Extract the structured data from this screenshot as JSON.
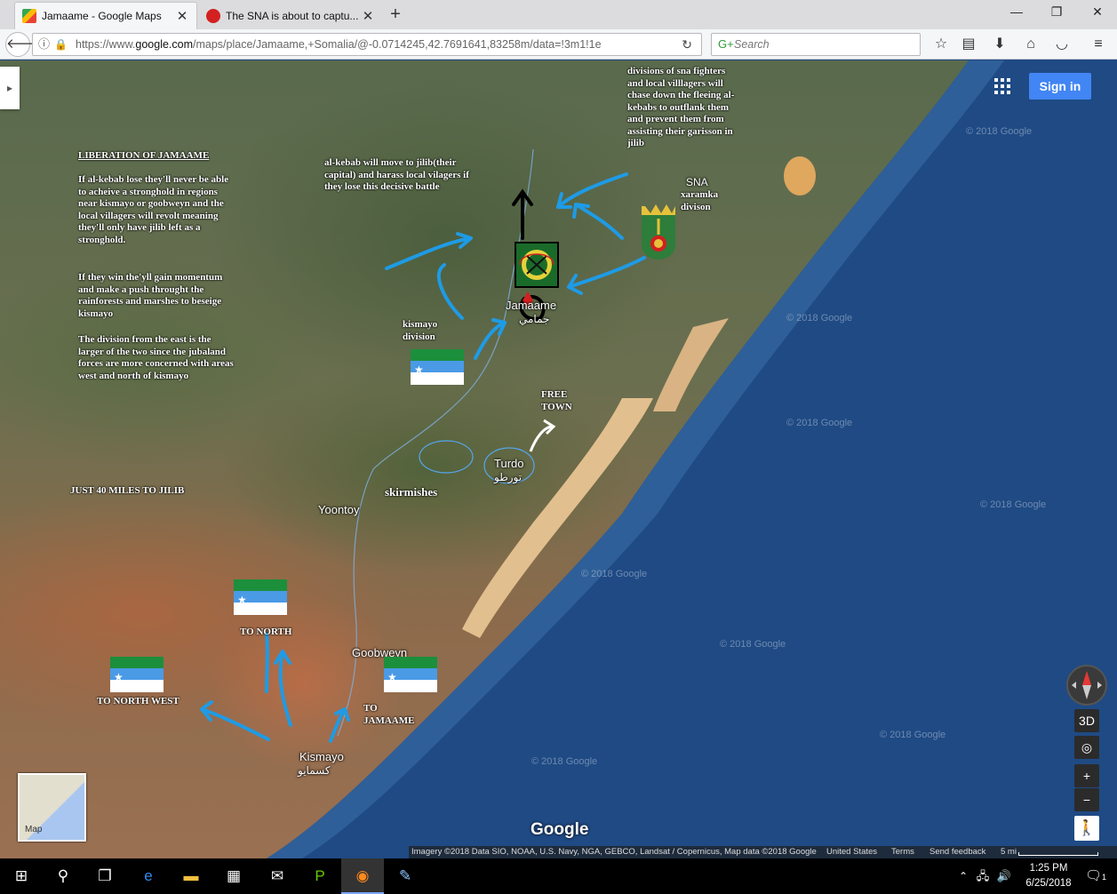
{
  "browser": {
    "tabs": [
      {
        "title": "Jamaame - Google Maps",
        "active": true,
        "favicon_color": "#4285f4"
      },
      {
        "title": "The SNA is about to captu...",
        "active": false,
        "favicon_color": "#d32020"
      }
    ],
    "new_tab_label": "+",
    "window_controls": {
      "minimize": "—",
      "restore": "❐",
      "close": "✕"
    },
    "url": {
      "prefix": "https://www.",
      "domain": "google.com",
      "path": "/maps/place/Jamaame,+Somalia/@-0.0714245,42.7691641,83258m/data=!3m1!1e"
    },
    "search_placeholder": "Search",
    "toolbar_icons": [
      "star-icon",
      "reading-list-icon",
      "download-icon",
      "home-icon",
      "pocket-icon",
      "menu-icon"
    ]
  },
  "map": {
    "place_labels": {
      "jamaame": "Jamaame",
      "jamaame_ar": "جمامي",
      "turdo": "Turdo",
      "turdo_ar": "تورطو",
      "yoontoy": "Yoontoy",
      "goobweyn": "Goobweyn",
      "kismayo": "Kismayo",
      "kismayo_ar": "كسمايو"
    },
    "annotations": {
      "liberation_title": "LIBERATION OF JAMAAME",
      "liberation_p1": "If al-kebab lose they'll never be able to acheive a stronghold in regions near kismayo or goobweyn and the local villagers will revolt meaning they'll only have jilib left as a stronghold.",
      "liberation_p2": "If they win the'yll gain momentum and make a push throught the rainforests and marshes to beseige kismayo",
      "liberation_p3": "The division from the east is the larger of the two since the jubaland forces are more concerned with areas west and north of kismayo",
      "alkebab_move": "al-kebab will move to jilib(their capital) and harass local vilagers if they lose this decisive battle",
      "divisions_chase": "divisions of sna fighters and local villlagers will chase down the fleeing al-kebabs to outflank them and prevent them from assisting their garisson in jilib",
      "sna_label": "SNA",
      "xaramka_label": "xaramka divison",
      "kismayo_division": "kismayo division",
      "free_town": "FREE TOWN",
      "skirmishes": "skirmishes",
      "just_40_miles": "JUST 40 MILES TO JILIB",
      "to_north": "TO NORTH",
      "to_north_west": "TO NORTH WEST",
      "to_jamaame": "TO JAMAAME"
    },
    "watermark": "© 2018 Google",
    "controls": {
      "signin": "Sign in",
      "view_3d": "3D",
      "zoom_in": "+",
      "zoom_out": "−",
      "minimap_label": "Map",
      "google_logo": "Google"
    },
    "attribution": {
      "imagery": "Imagery ©2018 Data SIO, NOAA, U.S. Navy, NGA, GEBCO, Landsat / Copernicus, Map data ©2018 Google",
      "country": "United States",
      "terms": "Terms",
      "feedback": "Send feedback",
      "scale": "5 mi"
    },
    "colors": {
      "somali_green": "#1c8f3c",
      "somali_blue": "#4a9ae6",
      "arrow_blue": "#1e9be6",
      "ocean": "#1f4a84"
    }
  },
  "taskbar": {
    "icons": [
      "windows-start-icon",
      "search-icon",
      "task-view-icon",
      "edge-icon",
      "file-explorer-icon",
      "store-icon",
      "mail-icon",
      "app-icon",
      "firefox-icon",
      "paint-icon"
    ],
    "time": "1:25 PM",
    "date": "6/25/2018",
    "notification_count": "1"
  }
}
